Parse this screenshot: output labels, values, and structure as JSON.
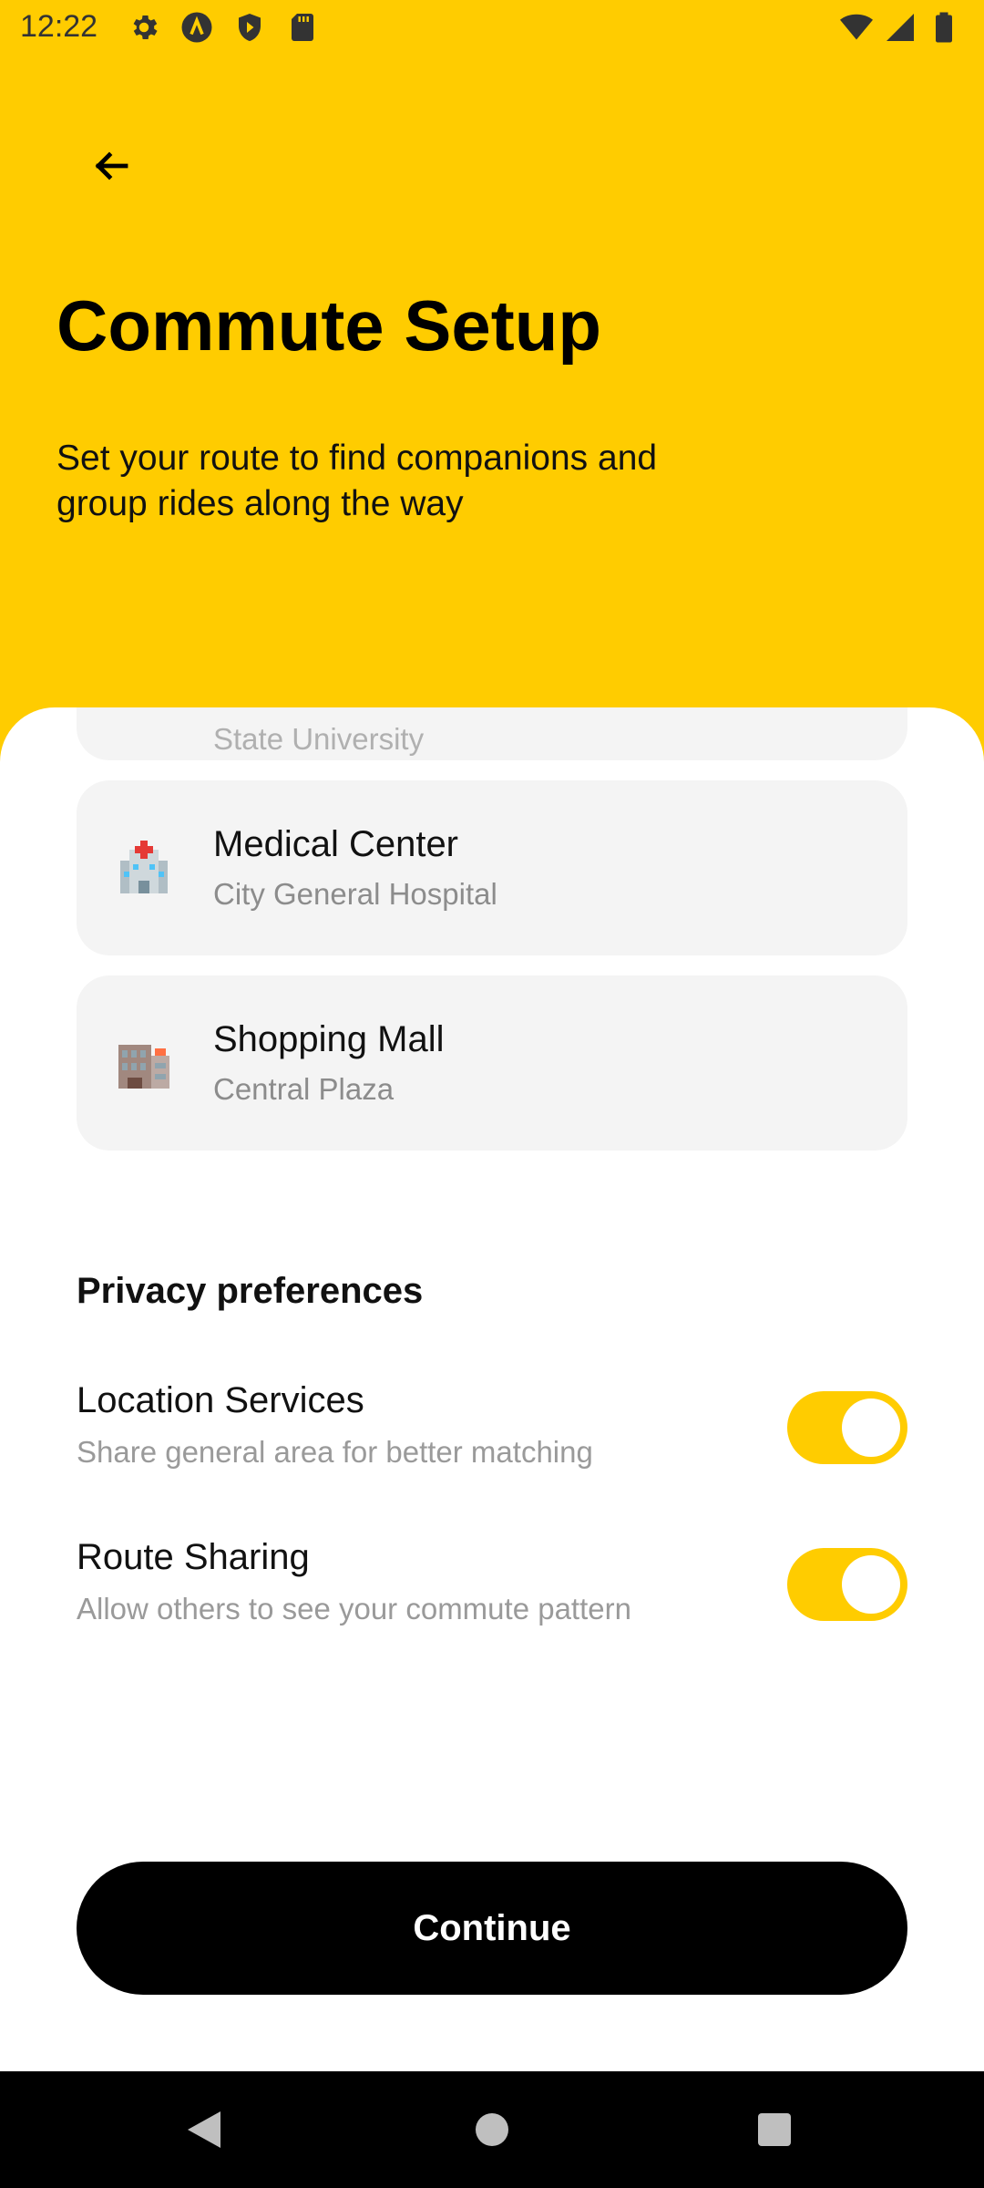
{
  "status_bar": {
    "time": "12:22",
    "left_icons": [
      "gear-icon",
      "a-logo-icon",
      "shield-icon",
      "sd-card-icon"
    ],
    "right_icons": [
      "wifi-icon",
      "signal-icon",
      "battery-icon"
    ]
  },
  "header": {
    "back_icon": "arrow-left-icon",
    "title": "Commute Setup",
    "subtitle": "Set your route to find companions and group rides along the way"
  },
  "destinations": [
    {
      "name": "",
      "subtitle": "State University",
      "icon": "university-icon",
      "partial": true
    },
    {
      "name": "Medical Center",
      "subtitle": "City General Hospital",
      "icon": "hospital-icon"
    },
    {
      "name": "Shopping Mall",
      "subtitle": "Central Plaza",
      "icon": "department-store-icon"
    }
  ],
  "privacy": {
    "title": "Privacy preferences",
    "items": [
      {
        "title": "Location Services",
        "description": "Share general area for better matching",
        "enabled": true
      },
      {
        "title": "Route Sharing",
        "description": "Allow others to see your commute pattern",
        "enabled": true
      }
    ]
  },
  "continue_label": "Continue",
  "colors": {
    "accent": "#FFCC00",
    "card_bg": "#F4F4F4",
    "button_bg": "#000000"
  },
  "nav_bar": {
    "buttons": [
      "back-triangle-icon",
      "home-circle-icon",
      "recents-square-icon"
    ]
  }
}
